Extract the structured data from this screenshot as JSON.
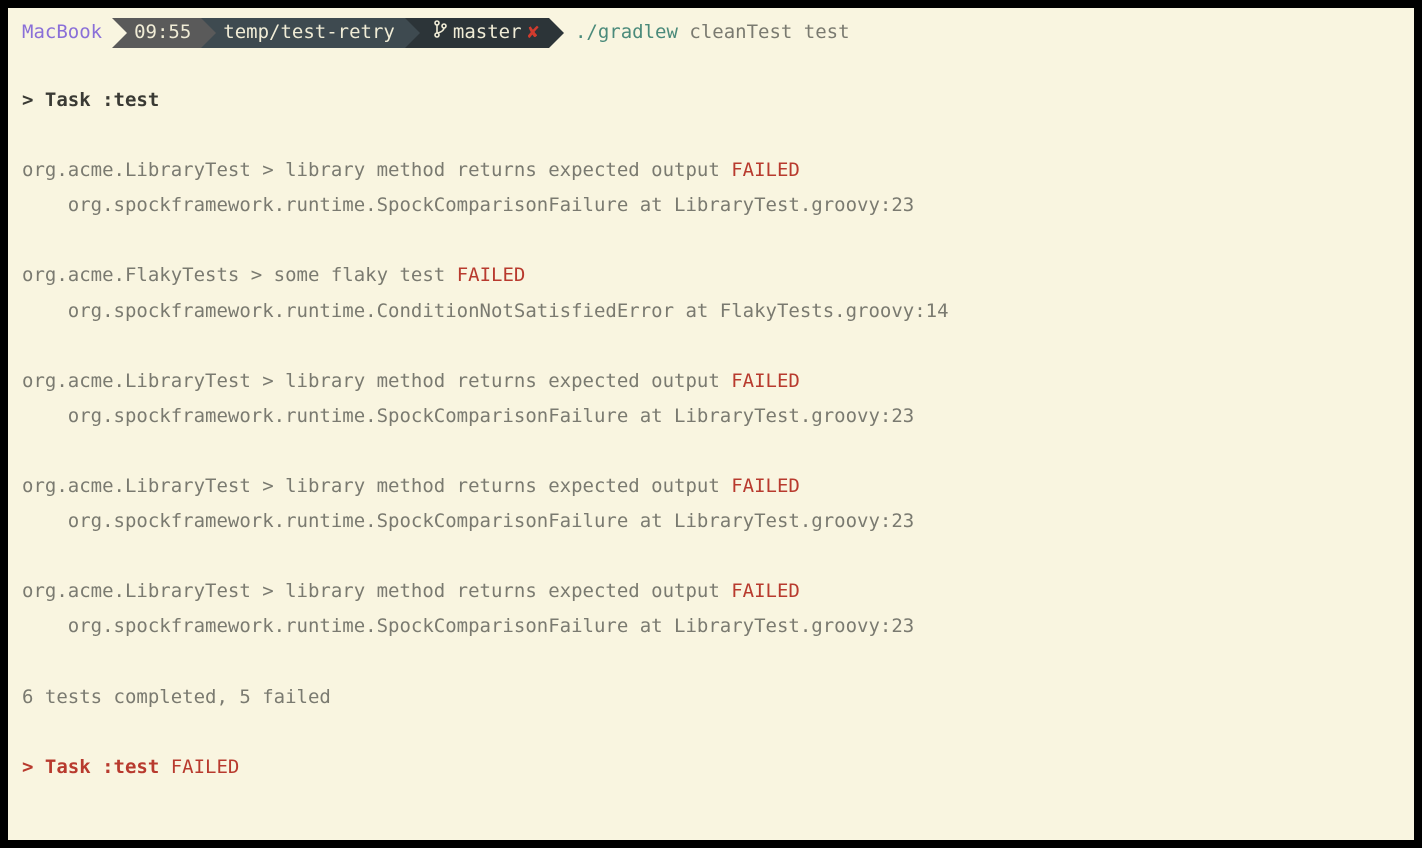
{
  "prompt": {
    "host": "MacBook",
    "time": "09:55",
    "path": "temp/test-retry",
    "branch": "master",
    "dirty_marker": "✘",
    "command_binary": "./gradlew",
    "command_args": "cleanTest test"
  },
  "output": {
    "task_header": "> Task :test",
    "failures": [
      {
        "header_prefix": "org.acme.LibraryTest > library method returns expected output ",
        "header_status": "FAILED",
        "detail": "    org.spockframework.runtime.SpockComparisonFailure at LibraryTest.groovy:23"
      },
      {
        "header_prefix": "org.acme.FlakyTests > some flaky test ",
        "header_status": "FAILED",
        "detail": "    org.spockframework.runtime.ConditionNotSatisfiedError at FlakyTests.groovy:14"
      },
      {
        "header_prefix": "org.acme.LibraryTest > library method returns expected output ",
        "header_status": "FAILED",
        "detail": "    org.spockframework.runtime.SpockComparisonFailure at LibraryTest.groovy:23"
      },
      {
        "header_prefix": "org.acme.LibraryTest > library method returns expected output ",
        "header_status": "FAILED",
        "detail": "    org.spockframework.runtime.SpockComparisonFailure at LibraryTest.groovy:23"
      },
      {
        "header_prefix": "org.acme.LibraryTest > library method returns expected output ",
        "header_status": "FAILED",
        "detail": "    org.spockframework.runtime.SpockComparisonFailure at LibraryTest.groovy:23"
      }
    ],
    "summary": "6 tests completed, 5 failed",
    "task_footer_prefix": "> Task :test ",
    "task_footer_status": "FAILED"
  }
}
